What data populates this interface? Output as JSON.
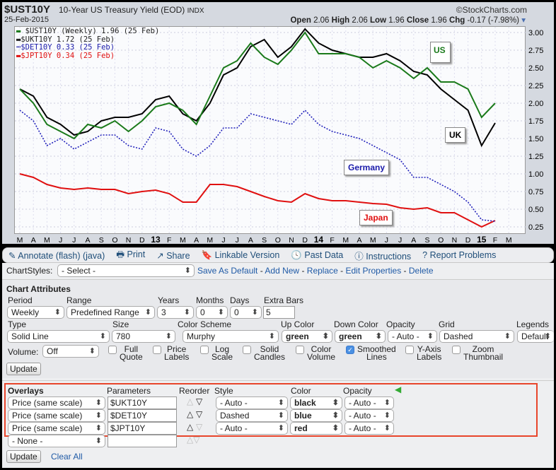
{
  "header": {
    "symbol": "$UST10Y",
    "name": "10-Year US Treasury Yield (EOD)",
    "exchange": "INDX",
    "date": "25-Feb-2015",
    "brand": "©StockCharts.com",
    "open_label": "Open",
    "open": "2.06",
    "high_label": "High",
    "high": "2.06",
    "low_label": "Low",
    "low": "1.96",
    "close_label": "Close",
    "close": "1.96",
    "chg_label": "Chg",
    "chg": "-0.17 (-7.98%)"
  },
  "legend": [
    {
      "text": "$UST10Y (Weekly) 1.96 (25 Feb)",
      "color": "#1a7a1a"
    },
    {
      "text": "$UKT10Y 1.72 (25 Feb)",
      "color": "#000000"
    },
    {
      "text": "$DET10Y 0.33 (25 Feb)",
      "color": "#1a1aaa"
    },
    {
      "text": "$JPT10Y 0.34 (25 Feb)",
      "color": "#e01010"
    }
  ],
  "annotations": {
    "us": "US",
    "uk": "UK",
    "germany": "Germany",
    "japan": "Japan"
  },
  "chart_data": {
    "type": "line",
    "ylim": [
      0.125,
      3.1
    ],
    "yticks": [
      "3.00",
      "2.75",
      "2.50",
      "2.25",
      "2.00",
      "1.75",
      "1.50",
      "1.25",
      "1.00",
      "0.75",
      "0.50",
      "0.25"
    ],
    "xticks": [
      "M",
      "A",
      "M",
      "J",
      "J",
      "A",
      "S",
      "O",
      "N",
      "D",
      "13",
      "F",
      "M",
      "A",
      "M",
      "J",
      "J",
      "A",
      "S",
      "O",
      "N",
      "D",
      "14",
      "F",
      "M",
      "A",
      "M",
      "J",
      "J",
      "A",
      "S",
      "O",
      "N",
      "D",
      "15",
      "F",
      "M"
    ],
    "series": [
      {
        "name": "$UST10Y",
        "color": "#1a7a1a",
        "style": "solid",
        "values": [
          2.2,
          2.0,
          1.7,
          1.6,
          1.5,
          1.7,
          1.65,
          1.75,
          1.6,
          1.75,
          1.95,
          2.0,
          1.9,
          1.7,
          2.1,
          2.5,
          2.6,
          2.85,
          2.65,
          2.55,
          2.75,
          3.0,
          2.7,
          2.7,
          2.7,
          2.65,
          2.5,
          2.6,
          2.5,
          2.35,
          2.5,
          2.3,
          2.3,
          2.2,
          1.8,
          2.0
        ]
      },
      {
        "name": "$UKT10Y",
        "color": "#000000",
        "style": "solid",
        "values": [
          2.2,
          2.1,
          1.8,
          1.7,
          1.55,
          1.6,
          1.75,
          1.8,
          1.8,
          1.85,
          2.05,
          2.1,
          1.85,
          1.75,
          2.0,
          2.4,
          2.5,
          2.8,
          2.9,
          2.65,
          2.8,
          3.05,
          2.85,
          2.75,
          2.7,
          2.65,
          2.65,
          2.7,
          2.6,
          2.45,
          2.4,
          2.2,
          2.05,
          1.9,
          1.4,
          1.72
        ]
      },
      {
        "name": "$DET10Y",
        "color": "#2222bb",
        "style": "dashed",
        "values": [
          1.9,
          1.75,
          1.4,
          1.5,
          1.35,
          1.45,
          1.55,
          1.55,
          1.4,
          1.35,
          1.65,
          1.6,
          1.35,
          1.25,
          1.4,
          1.65,
          1.65,
          1.85,
          1.8,
          1.75,
          1.7,
          1.9,
          1.7,
          1.6,
          1.55,
          1.5,
          1.4,
          1.3,
          1.2,
          0.95,
          0.95,
          0.85,
          0.75,
          0.6,
          0.35,
          0.33
        ]
      },
      {
        "name": "$JPT10Y",
        "color": "#e01010",
        "style": "solid",
        "values": [
          1.0,
          0.95,
          0.85,
          0.8,
          0.78,
          0.8,
          0.78,
          0.78,
          0.72,
          0.75,
          0.77,
          0.72,
          0.6,
          0.6,
          0.85,
          0.85,
          0.82,
          0.75,
          0.68,
          0.62,
          0.6,
          0.72,
          0.65,
          0.62,
          0.62,
          0.6,
          0.58,
          0.57,
          0.52,
          0.5,
          0.52,
          0.45,
          0.45,
          0.35,
          0.25,
          0.34
        ]
      }
    ]
  },
  "toolbar": [
    "Annotate (flash) (java)",
    "Print",
    "Share",
    "Linkable Version",
    "Past Data",
    "Instructions",
    "Report Problems"
  ],
  "chartstyles": {
    "label": "ChartStyles:",
    "value": "- Select -",
    "links": [
      "Save As Default",
      "Add New",
      "Replace",
      "Edit Properties",
      "Delete"
    ]
  },
  "attributes": {
    "title": "Chart Attributes",
    "period_label": "Period",
    "period": "Weekly",
    "range_label": "Range",
    "range": "Predefined Range",
    "years_label": "Years",
    "years": "3",
    "months_label": "Months",
    "months": "0",
    "days_label": "Days",
    "days": "0",
    "extra_label": "Extra Bars",
    "extra": "5",
    "type_label": "Type",
    "type": "Solid Line",
    "size_label": "Size",
    "size": "780",
    "scheme_label": "Color Scheme",
    "scheme": "Murphy",
    "up_label": "Up Color",
    "up": "green",
    "down_label": "Down Color",
    "down": "green",
    "opacity_label": "Opacity",
    "opacity": "- Auto -",
    "grid_label": "Grid",
    "grid": "Dashed",
    "legends_label": "Legends",
    "legends": "Default",
    "volume_label": "Volume:",
    "volume": "Off",
    "checks": [
      {
        "l1": "Full",
        "l2": "Quote",
        "on": false
      },
      {
        "l1": "Price",
        "l2": "Labels",
        "on": false
      },
      {
        "l1": "Log",
        "l2": "Scale",
        "on": false
      },
      {
        "l1": "Solid",
        "l2": "Candles",
        "on": false
      },
      {
        "l1": "Color",
        "l2": "Volume",
        "on": false
      },
      {
        "l1": "Smoothed",
        "l2": "Lines",
        "on": true
      },
      {
        "l1": "Y-Axis",
        "l2": "Labels",
        "on": false
      },
      {
        "l1": "Zoom",
        "l2": "Thumbnail",
        "on": false
      }
    ],
    "update": "Update"
  },
  "overlays": {
    "h_overlays": "Overlays",
    "h_params": "Parameters",
    "h_reorder": "Reorder",
    "h_style": "Style",
    "h_color": "Color",
    "h_opacity": "Opacity",
    "rows": [
      {
        "type": "Price (same scale)",
        "param": "$UKT10Y",
        "style": "- Auto -",
        "color": "black",
        "opacity": "- Auto -"
      },
      {
        "type": "Price (same scale)",
        "param": "$DET10Y",
        "style": "Dashed",
        "color": "blue",
        "opacity": "- Auto -"
      },
      {
        "type": "Price (same scale)",
        "param": "$JPT10Y",
        "style": "- Auto -",
        "color": "red",
        "opacity": "- Auto -"
      }
    ],
    "empty_row": "- None -",
    "update": "Update",
    "clear": "Clear All"
  }
}
